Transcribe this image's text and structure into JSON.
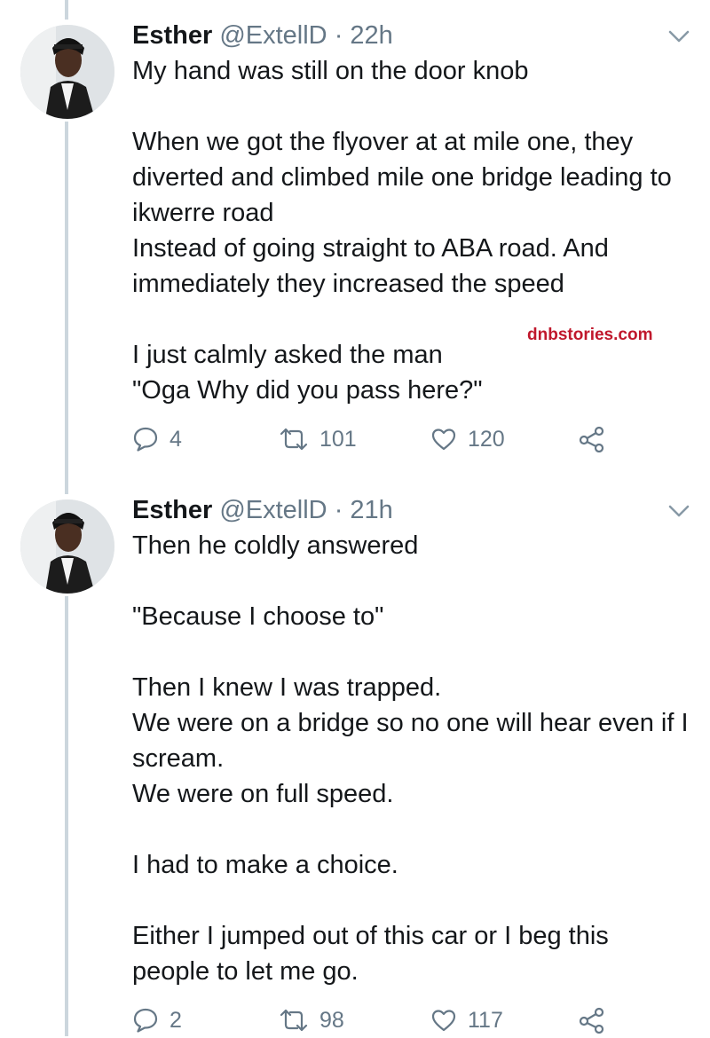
{
  "watermark": "dnbstories.com",
  "tweets": [
    {
      "display_name": "Esther",
      "handle": "@ExtellD",
      "separator": "·",
      "time": "22h",
      "text": "My hand was still on the door knob\n\nWhen we got the flyover at at mile one, they diverted and  climbed mile one bridge leading to ikwerre road\nInstead of going straight to ABA road. And immediately they increased the speed\n\nI just calmly asked the man\n\"Oga Why did you pass here?\"",
      "replies": "4",
      "retweets": "101",
      "likes": "120"
    },
    {
      "display_name": "Esther",
      "handle": "@ExtellD",
      "separator": "·",
      "time": "21h",
      "text": "Then he coldly answered\n\n\"Because I choose to\"\n\nThen I knew I was trapped.\nWe were on a bridge so no one will hear even if I scream.\nWe were on full speed.\n\nI had to make a choice.\n\nEither I jumped out of this car or I beg this people to let me go.",
      "replies": "2",
      "retweets": "98",
      "likes": "117"
    }
  ],
  "colors": {
    "text": "#14171a",
    "secondary": "#657786",
    "thread_line": "#ccd6dd",
    "watermark": "#c0182c"
  },
  "icons": {
    "reply": "reply-icon",
    "retweet": "retweet-icon",
    "like": "heart-icon",
    "share": "share-icon",
    "menu": "chevron-down-icon"
  }
}
